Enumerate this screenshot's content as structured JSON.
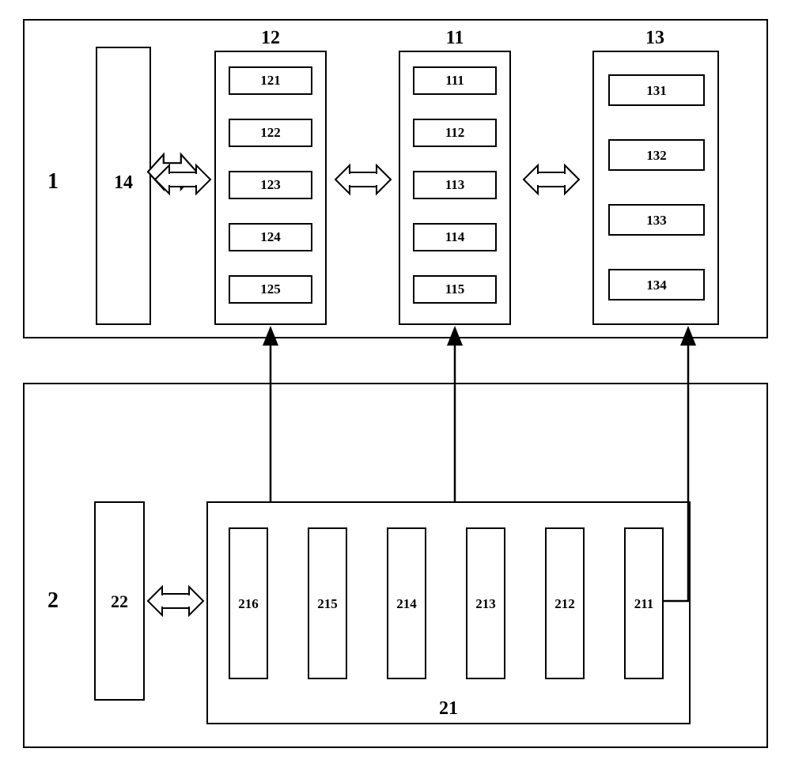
{
  "top": {
    "label": "1",
    "m14": "14",
    "m12": {
      "label": "12",
      "items": [
        "121",
        "122",
        "123",
        "124",
        "125"
      ]
    },
    "m11": {
      "label": "11",
      "items": [
        "111",
        "112",
        "113",
        "114",
        "115"
      ]
    },
    "m13": {
      "label": "13",
      "items": [
        "131",
        "132",
        "133",
        "134"
      ]
    }
  },
  "bottom": {
    "label": "2",
    "m22": "22",
    "m21": {
      "label": "21",
      "items": [
        "216",
        "215",
        "214",
        "213",
        "212",
        "211"
      ]
    }
  }
}
